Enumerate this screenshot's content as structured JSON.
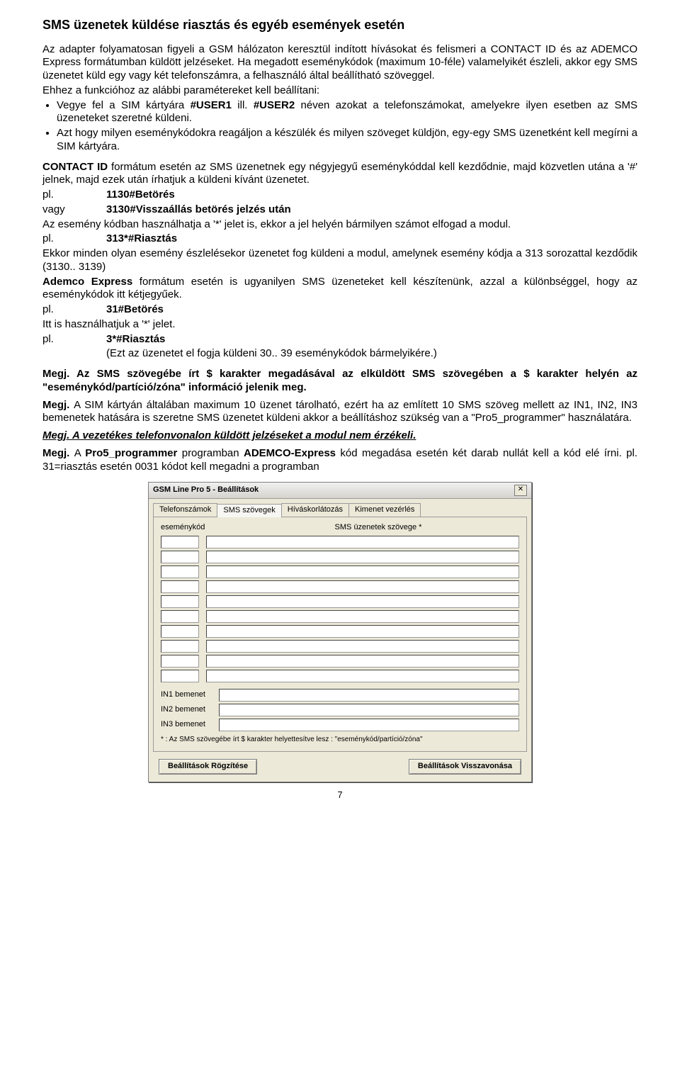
{
  "title": "SMS üzenetek küldése riasztás és egyéb események esetén",
  "p1": "Az adapter folyamatosan figyeli a GSM hálózaton keresztül indított hívásokat és felismeri a CONTACT ID és az ADEMCO Express formátumban küldött jelzéseket. Ha megadott eseménykódok (maximum 10-féle) valamelyikét észleli, akkor egy SMS üzenetet küld egy vagy két telefonszámra, a felhasználó által beállítható szöveggel.",
  "p2": "Ehhez a funkcióhoz az alábbi paramétereket kell beállítani:",
  "li1a": "Vegye fel a SIM kártyára ",
  "li1b": "#USER1",
  "li1c": " ill. ",
  "li1d": "#USER2",
  "li1e": " néven azokat a telefonszámokat, amelyekre ilyen esetben az SMS üzeneteket szeretné küldeni.",
  "li2": "Azt hogy milyen eseménykódokra reagáljon a készülék és milyen szöveget küldjön, egy-egy SMS üzenetként kell megírni a SIM kártyára.",
  "p3a": "CONTACT ID ",
  "p3b": "formátum esetén az SMS üzenetnek egy négyjegyű eseménykóddal kell kezdődnie, majd közvetlen utána a '#' jelnek, majd ezek után írhatjuk a küldeni kívánt üzenetet.",
  "row1_l": "pl.",
  "row1_r": "1130#Betörés",
  "row2_l": "vagy",
  "row2_r": "3130#Visszaállás betörés jelzés után",
  "p4": "Az esemény kódban használhatja a '*' jelet is, ekkor a jel helyén bármilyen számot elfogad a modul.",
  "row3_l": "pl.",
  "row3_r": "313*#Riasztás",
  "p5": "Ekkor minden olyan esemény észlelésekor üzenetet fog küldeni a modul, amelynek esemény kódja a 313 sorozattal kezdődik (3130.. 3139)",
  "p6a": "Ademco Express ",
  "p6b": "formátum esetén is ugyanilyen SMS üzeneteket kell készítenünk, azzal a különbséggel, hogy az eseménykódok itt kétjegyűek.",
  "row4_l": "pl.",
  "row4_r": "31#Betörés",
  "p7": "Itt is használhatjuk a '*' jelet.",
  "row5_l": "pl.",
  "row5_r": "3*#Riasztás",
  "p8": "(Ezt az üzenetet el fogja küldeni 30.. 39 eseménykódok bármelyikére.)",
  "n1a": "Megj. ",
  "n1b": "Az SMS szövegébe írt $ karakter megadásával az elküldött SMS szövegében a $ karakter helyén az \"eseménykód/partíció/zóna\" információ jelenik meg.",
  "n2a": "Megj. ",
  "n2b": "A SIM kártyán általában maximum 10 üzenet tárolható, ezért ha az említett 10 SMS szöveg mellett az IN1, IN2, IN3 bemenetek hatására is szeretne SMS üzenetet küldeni akkor a beállításhoz szükség van a \"Pro5_programmer\" használatára.",
  "n3": "Megj. A vezetékes telefonvonalon küldött jelzéseket a modul nem érzékeli.",
  "n4a": "Megj. ",
  "n4b": "A ",
  "n4c": "Pro5_programmer",
  "n4d": " programban ",
  "n4e": "ADEMCO-Express",
  "n4f": " kód megadása esetén két darab nullát kell a kód elé írni.  pl. 31=riasztás esetén 0031 kódot kell megadni a programban",
  "dlg": {
    "title": "GSM Line Pro 5  -  Beállítások",
    "tabs": [
      "Telefonszámok",
      "SMS szövegek",
      "Híváskorlátozás",
      "Kimenet vezérlés"
    ],
    "col1": "eseménykód",
    "col2": "SMS üzenetek szövege *",
    "in_labels": [
      "IN1 bemenet",
      "IN2 bemenet",
      "IN3 bemenet"
    ],
    "note": "*  : Az SMS szövegébe írt $ karakter helyettesítve lesz : \"eseménykód/partíció/zóna\"",
    "btn_save": "Beállítások Rögzítése",
    "btn_cancel": "Beállítások Visszavonása"
  },
  "pagenum": "7"
}
